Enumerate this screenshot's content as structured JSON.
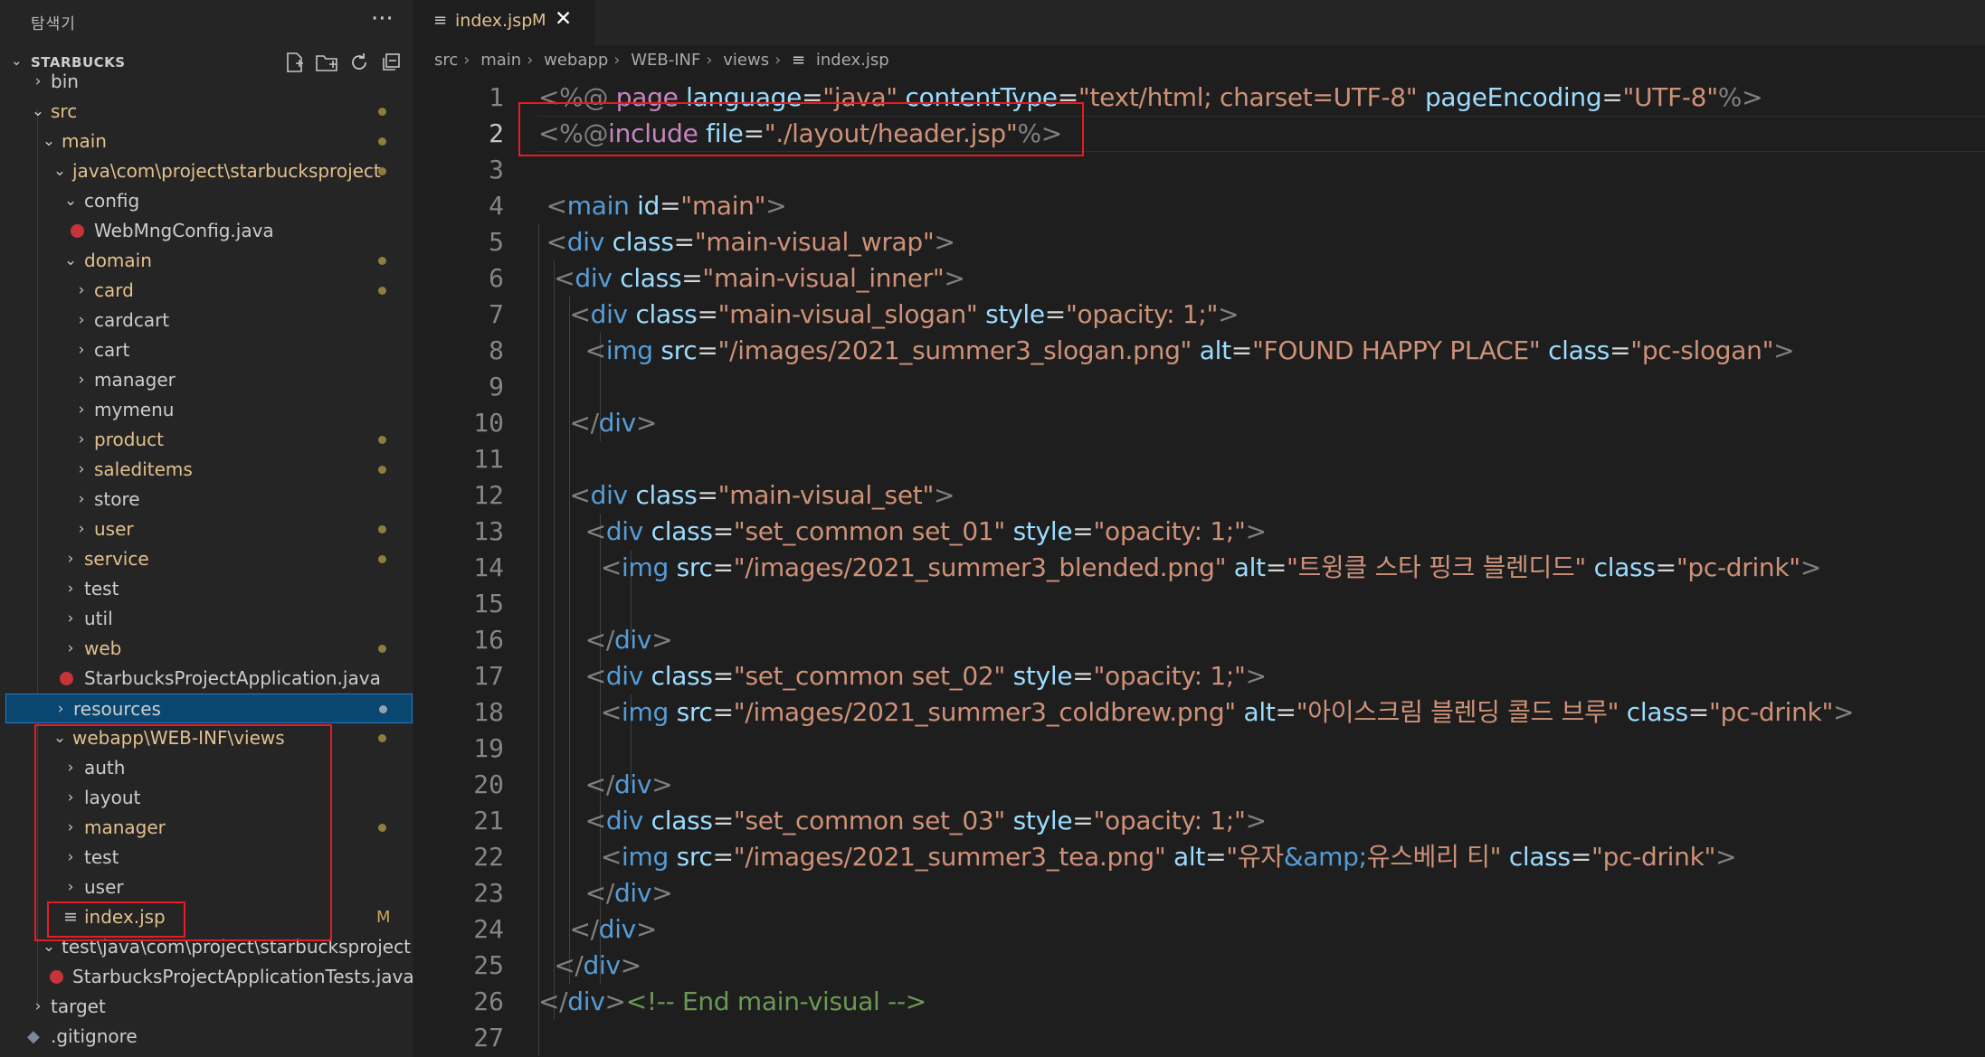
{
  "sidebar": {
    "title": "탐색기",
    "more": "···",
    "section": "STARBUCKS",
    "actions": [
      "new-file-icon",
      "new-folder-icon",
      "refresh-icon",
      "collapse-icon"
    ],
    "items": [
      {
        "label": "bin"
      },
      {
        "label": "src"
      },
      {
        "label": "main"
      },
      {
        "label": "java\\com\\project\\starbucksproject"
      },
      {
        "label": "config"
      },
      {
        "label": "WebMngConfig.java"
      },
      {
        "label": "domain"
      },
      {
        "label": "card"
      },
      {
        "label": "cardcart"
      },
      {
        "label": "cart"
      },
      {
        "label": "manager"
      },
      {
        "label": "mymenu"
      },
      {
        "label": "product"
      },
      {
        "label": "saleditems"
      },
      {
        "label": "store"
      },
      {
        "label": "user"
      },
      {
        "label": "service"
      },
      {
        "label": "test"
      },
      {
        "label": "util"
      },
      {
        "label": "web"
      },
      {
        "label": "StarbucksProjectApplication.java"
      },
      {
        "label": "resources"
      },
      {
        "label": "webapp\\WEB-INF\\views"
      },
      {
        "label": "auth"
      },
      {
        "label": "layout"
      },
      {
        "label": "manager"
      },
      {
        "label": "test"
      },
      {
        "label": "user"
      },
      {
        "label": "index.jsp",
        "badge": "M"
      },
      {
        "label": "test\\java\\com\\project\\starbucksproject"
      },
      {
        "label": "StarbucksProjectApplicationTests.java"
      },
      {
        "label": "target"
      },
      {
        "label": ".gitignore"
      }
    ]
  },
  "editor": {
    "tab": {
      "name": "index.jsp",
      "modified": "M",
      "close": "✕"
    },
    "breadcrumb": [
      "src",
      "main",
      "webapp",
      "WEB-INF",
      "views",
      "index.jsp"
    ],
    "current_line": 2,
    "line_numbers": [
      "1",
      "2",
      "3",
      "4",
      "5",
      "6",
      "7",
      "8",
      "9",
      "10",
      "11",
      "12",
      "13",
      "14",
      "15",
      "16",
      "17",
      "18",
      "19",
      "20",
      "21",
      "22",
      "23",
      "24",
      "25",
      "26",
      "27"
    ],
    "lines": [
      "<%@ page language=\"java\" contentType=\"text/html; charset=UTF-8\" pageEncoding=\"UTF-8\"%>",
      "<%@include file=\"./layout/header.jsp\"%>",
      "",
      " <main id=\"main\">",
      " <div class=\"main-visual_wrap\">",
      "  <div class=\"main-visual_inner\">",
      "    <div class=\"main-visual_slogan\" style=\"opacity: 1;\">",
      "      <img src=\"/images/2021_summer3_slogan.png\" alt=\"FOUND HAPPY PLACE\" class=\"pc-slogan\">",
      "",
      "    </div>",
      "",
      "    <div class=\"main-visual_set\">",
      "      <div class=\"set_common set_01\" style=\"opacity: 1;\">",
      "        <img src=\"/images/2021_summer3_blended.png\" alt=\"트윙클 스타 핑크 블렌디드\" class=\"pc-drink\">",
      "",
      "      </div>",
      "      <div class=\"set_common set_02\" style=\"opacity: 1;\">",
      "        <img src=\"/images/2021_summer3_coldbrew.png\" alt=\"아이스크림 블렌딩 콜드 브루\" class=\"pc-drink\">",
      "",
      "      </div>",
      "      <div class=\"set_common set_03\" style=\"opacity: 1;\">",
      "        <img src=\"/images/2021_summer3_tea.png\" alt=\"유자&amp;유스베리 티\" class=\"pc-drink\">",
      "      </div>",
      "    </div>",
      "  </div>",
      "</div><!-- End main-visual -->",
      ""
    ]
  },
  "colors": {
    "sidebar_bg": "#252526",
    "editor_bg": "#1e1e1e",
    "selection": "#094771",
    "modified": "#e2c08d",
    "highlight_box": "#e51c23"
  }
}
